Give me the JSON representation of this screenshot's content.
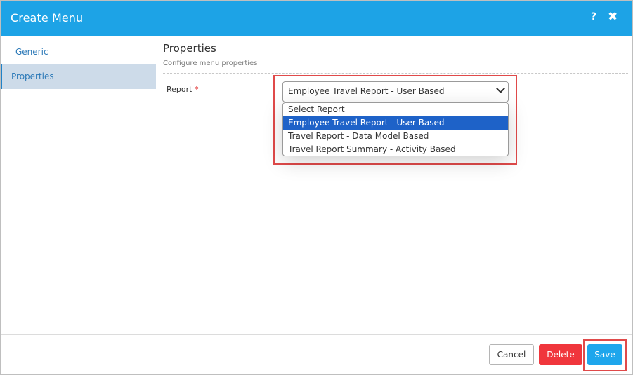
{
  "header": {
    "title": "Create Menu",
    "help_glyph": "?",
    "close_glyph": "✖",
    "background_color": "#1da3e6"
  },
  "sidebar": {
    "items": [
      {
        "label": "Generic",
        "active": false
      },
      {
        "label": "Properties",
        "active": true
      }
    ]
  },
  "main": {
    "section_title": "Properties",
    "section_subtitle": "Configure menu properties",
    "report_field": {
      "label": "Report",
      "required_marker": "*",
      "selected_value": "Employee Travel Report - User Based",
      "options": [
        "Select Report",
        "Employee Travel Report - User Based",
        "Travel Report - Data Model Based",
        "Travel Report Summary - Activity Based"
      ],
      "highlighted_option_index": 1
    }
  },
  "footer": {
    "cancel_label": "Cancel",
    "delete_label": "Delete",
    "save_label": "Save",
    "delete_color": "#f0363c",
    "save_color": "#1ea6ec"
  }
}
